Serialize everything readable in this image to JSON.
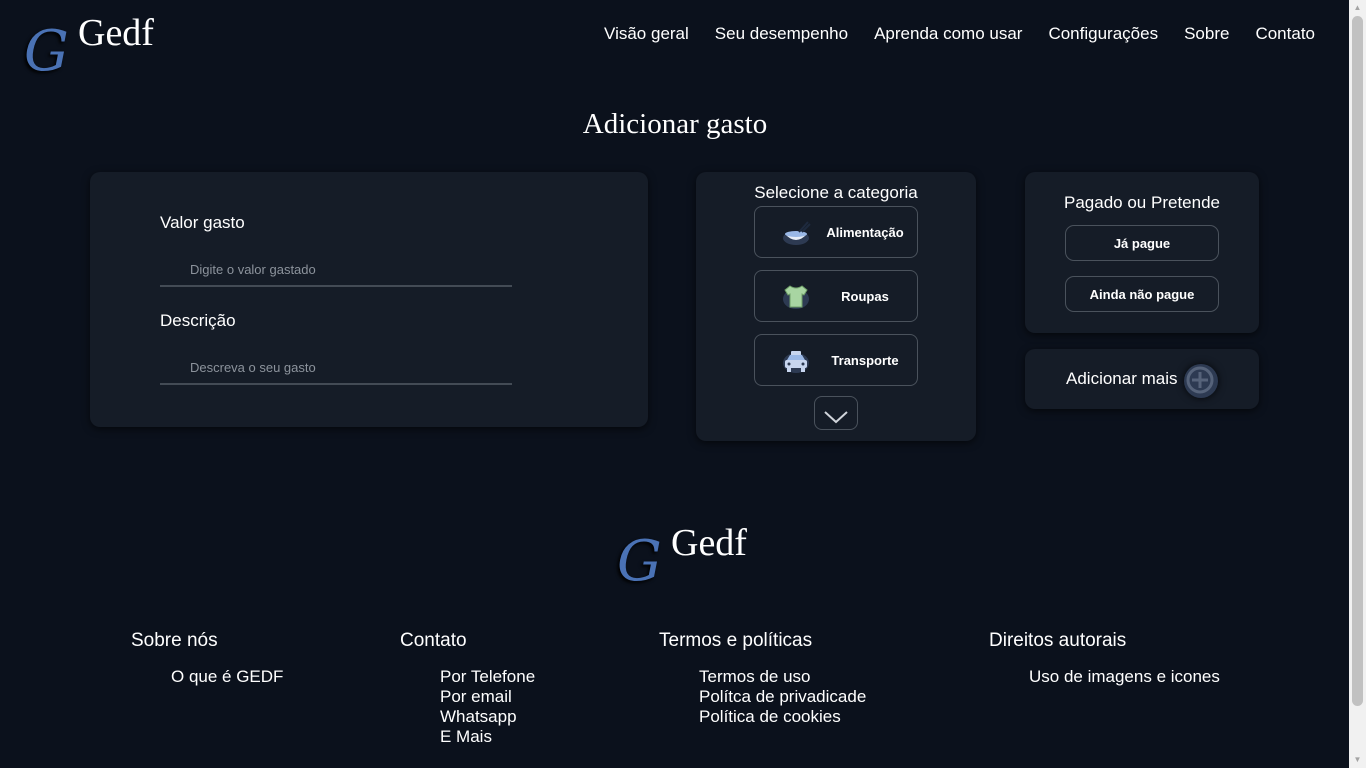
{
  "brand": {
    "name": "Gedf",
    "mark": "G"
  },
  "nav": [
    "Visão geral",
    "Seu desempenho",
    "Aprenda como usar",
    "Configurações",
    "Sobre",
    "Contato"
  ],
  "page_title": "Adicionar gasto",
  "form": {
    "value_label": "Valor gasto",
    "value_placeholder": "Digite o valor gastado",
    "value_current": "",
    "desc_label": "Descrição",
    "desc_placeholder": "Descreva o seu gasto",
    "desc_current": ""
  },
  "categories": {
    "title": "Selecione a categoria",
    "items": [
      {
        "label": "Alimentação",
        "icon": "food-bowl-icon"
      },
      {
        "label": "Roupas",
        "icon": "shirt-icon"
      },
      {
        "label": "Transporte",
        "icon": "car-icon"
      }
    ],
    "more_icon": "chevron-down-icon"
  },
  "payment": {
    "title": "Pagado ou Pretende",
    "paid": "Já pague",
    "unpaid": "Ainda não pague"
  },
  "add_more": {
    "label": "Adicionar mais",
    "icon": "plus-circle-icon"
  },
  "footer": {
    "sections": [
      {
        "title": "Sobre nós",
        "links": [
          "O que é GEDF"
        ]
      },
      {
        "title": "Contato",
        "links": [
          "Por Telefone",
          "Por email",
          "Whatsapp",
          "E Mais"
        ]
      },
      {
        "title": "Termos e políticas",
        "links": [
          "Termos de uso",
          "Polítca de privadicade",
          "Política de cookies"
        ]
      },
      {
        "title": "Direitos autorais",
        "links": [
          "Uso de imagens e icones"
        ]
      }
    ]
  },
  "colors": {
    "background": "#0b111c",
    "card": "#151c27",
    "border": "#4a525c",
    "logo_accent": "#4a72b5"
  }
}
